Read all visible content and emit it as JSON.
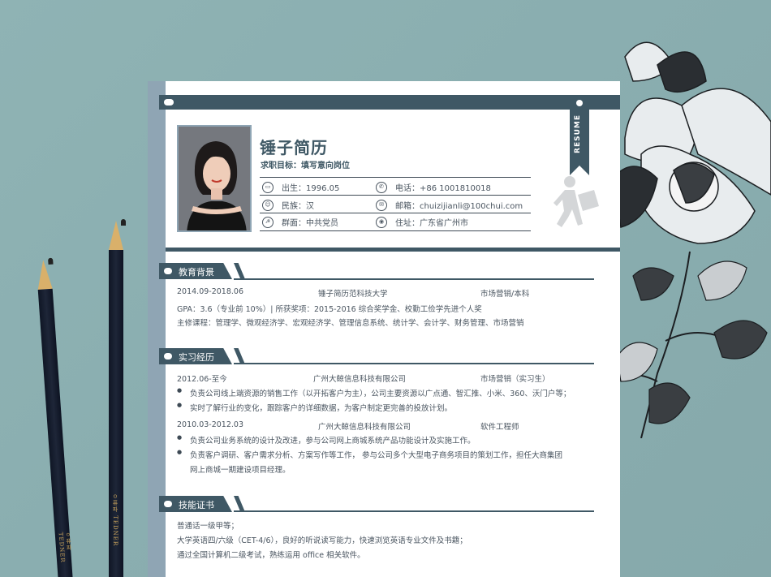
{
  "resume": {
    "ribbon_text": "RESUME",
    "name": "锤子简历",
    "target_label": "求职目标：",
    "target_value": "填写意向岗位",
    "info": {
      "birth": "出生：1996.05",
      "phone": "电话：+86 1001810018",
      "ethnicity": "民族：汉",
      "email": "邮箱：chuizijianli@100chui.com",
      "political": "群面：中共党员",
      "address": "住址：广东省广州市"
    }
  },
  "education": {
    "title": "教育背景",
    "period": "2014.09-2018.06",
    "school": "锤子简历范科技大学",
    "major": "市场营销/本科",
    "gpa": "GPA：3.6（专业前 10%）| 所获奖项：2015-2016 综合奖学金、校勤工俭学先进个人奖",
    "courses": "主修课程：管理学、微观经济学、宏观经济学、管理信息系统、统计学、会计学、财务管理、市场营销"
  },
  "internship": {
    "title": "实习经历",
    "jobs": [
      {
        "period": "2012.06-至今",
        "company": "广州大鲸信息科技有限公司",
        "role": "市场营销（实习生）",
        "bullets": [
          "负责公司线上端资源的销售工作（以开拓客户为主），公司主要资源以广点通、智汇推、小米、360、沃门户等；",
          "实时了解行业的变化，跟踪客户的详细数据，为客户制定更完善的投放计划。"
        ]
      },
      {
        "period": "2010.03-2012.03",
        "company": "广州大鲸信息科技有限公司",
        "role": "软件工程师",
        "bullets": [
          "负责公司业务系统的设计及改进，参与公司网上商城系统产品功能设计及实施工作。",
          "负责客户调研、客户需求分析、方案写作等工作，  参与公司多个大型电子商务项目的策划工作，担任大商集团",
          "网上商城一期建设项目经理。"
        ]
      }
    ]
  },
  "skills": {
    "title": "技能证书",
    "lines": [
      "普通话一级甲等；",
      "大学英语四/六级（CET-4/6），良好的听说读写能力，快速浏览英语专业文件及书籍；",
      "通过全国计算机二级考试，熟练运用 office 相关软件。"
    ]
  },
  "pencil_brand": "ㅇ퓨파 TEDNER",
  "colors": {
    "accent": "#3f5865",
    "sidebar": "#8fa5b4",
    "background": "#8fb3b4"
  }
}
